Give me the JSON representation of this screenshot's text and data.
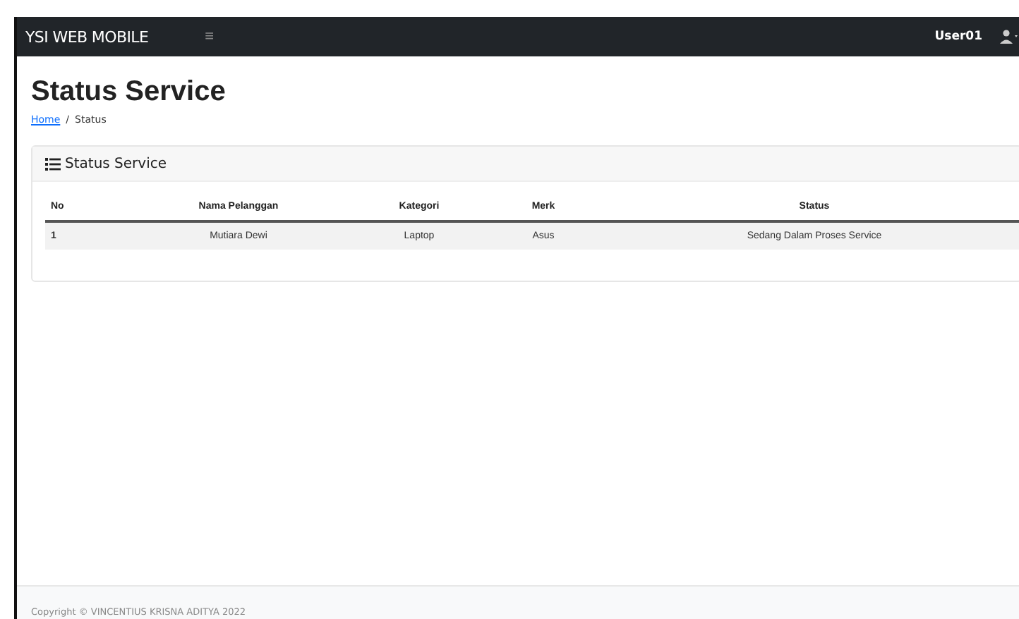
{
  "navbar": {
    "brand": "YSI WEB MOBILE",
    "menu_icon": "≡",
    "user": "User01"
  },
  "page": {
    "title": "Status Service",
    "breadcrumb": [
      {
        "label": "Home",
        "link": true
      },
      {
        "label": "Status",
        "link": false
      }
    ],
    "breadcrumb_separator": "/"
  },
  "card": {
    "title": "Status Service",
    "table": {
      "columns": [
        "No",
        "Nama Pelanggan",
        "Kategori",
        "Merk",
        "Status"
      ],
      "rows": [
        [
          "1",
          "Mutiara Dewi",
          "Laptop",
          "Asus",
          "Sedang Dalam Proses Service"
        ]
      ]
    }
  },
  "footer": "Copyright © VINCENTIUS KRISNA ADITYA 2022"
}
